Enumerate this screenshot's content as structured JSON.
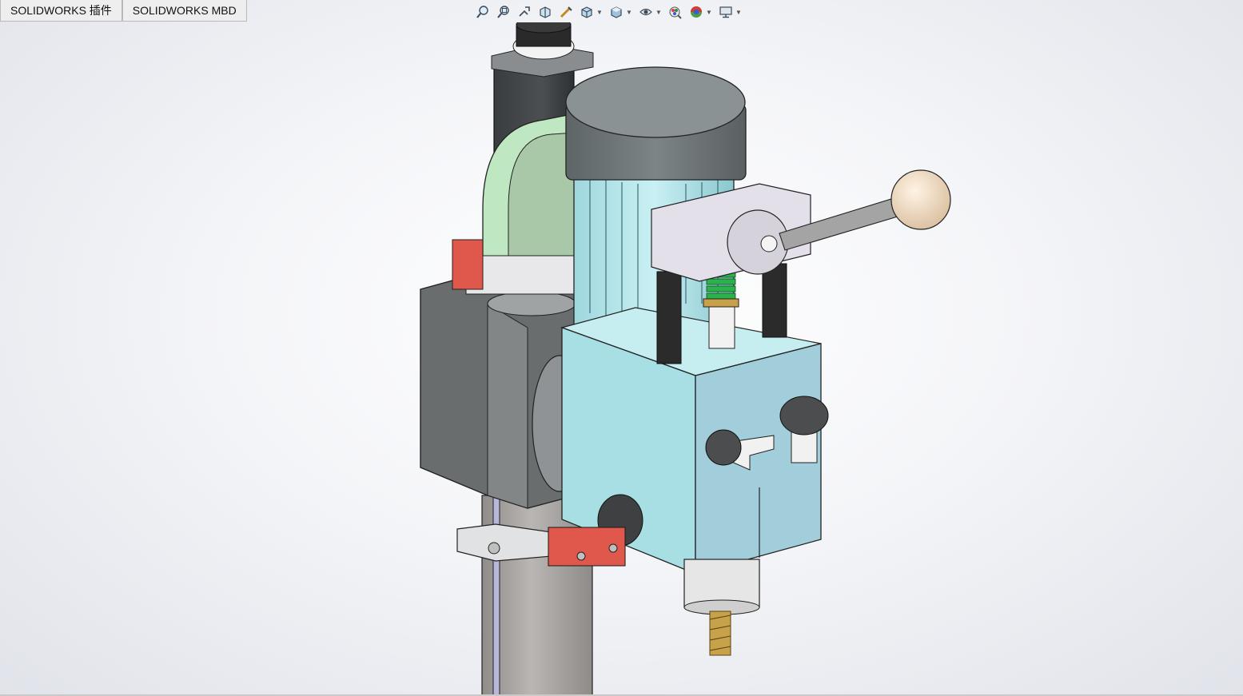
{
  "tabs": [
    {
      "label": "SOLIDWORKS 插件"
    },
    {
      "label": "SOLIDWORKS MBD"
    }
  ],
  "heads_up_toolbar": [
    {
      "icon": "zoom-to-fit-icon",
      "dropdown": false
    },
    {
      "icon": "zoom-to-area-icon",
      "dropdown": false
    },
    {
      "icon": "previous-view-icon",
      "dropdown": false
    },
    {
      "icon": "section-view-icon",
      "dropdown": false
    },
    {
      "icon": "dynamic-annotation-icon",
      "dropdown": false
    },
    {
      "icon": "view-orientation-icon",
      "dropdown": true
    },
    {
      "icon": "display-style-icon",
      "dropdown": true
    },
    {
      "icon": "hide-show-items-icon",
      "dropdown": true
    },
    {
      "icon": "edit-appearance-icon",
      "dropdown": false
    },
    {
      "icon": "apply-scene-icon",
      "dropdown": true
    },
    {
      "icon": "view-settings-icon",
      "dropdown": true
    }
  ],
  "colors": {
    "column": "#a9a6a4",
    "head_body": "#a7dfe4",
    "motor_cap": "#6d7578",
    "gear_cover": "#bfe8c2",
    "gearbox": "#6c6f70",
    "switch_red": "#e0584c",
    "handle_ball": "#f1dcc4",
    "spring": "#2bb34b"
  }
}
